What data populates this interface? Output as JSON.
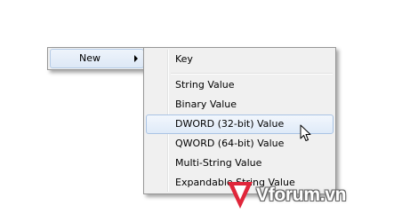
{
  "parent_menu": {
    "items": [
      {
        "label": "New",
        "has_submenu": true
      }
    ]
  },
  "submenu": {
    "items": [
      {
        "label": "Key"
      },
      {
        "label": "String Value"
      },
      {
        "label": "Binary Value"
      },
      {
        "label": "DWORD (32-bit) Value",
        "highlighted": true
      },
      {
        "label": "QWORD (64-bit) Value"
      },
      {
        "label": "Multi-String Value"
      },
      {
        "label": "Expandable String Value"
      }
    ]
  },
  "cursor": {
    "icon": "arrow-pointer-icon"
  },
  "watermark": {
    "text": "Vforum.vn",
    "logo_icon": "vforum-v-logo",
    "logo_color": "#e0263a"
  }
}
